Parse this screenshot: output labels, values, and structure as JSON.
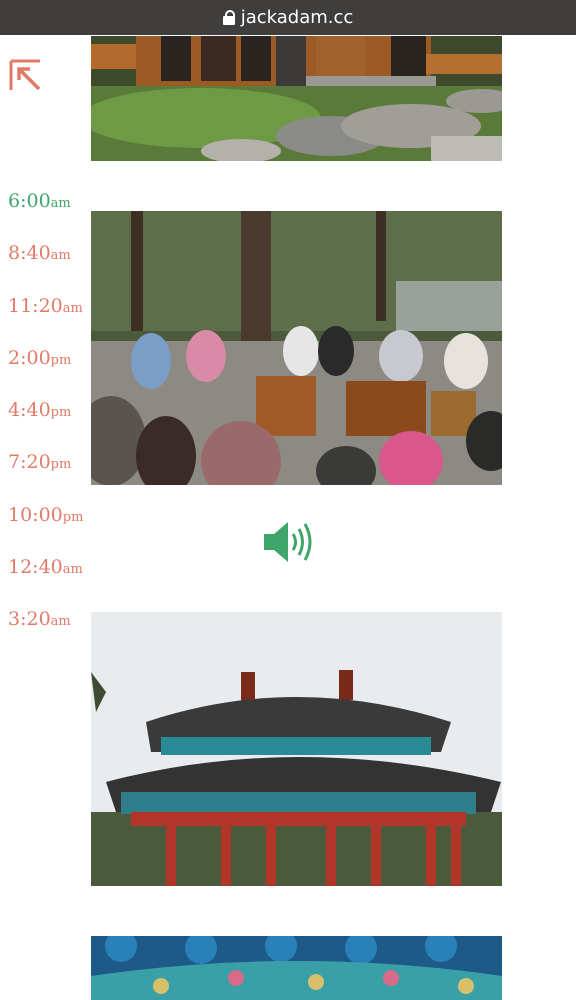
{
  "browser": {
    "url": "jackadam.cc"
  },
  "nav": {
    "back_icon": "arrow-up-left-icon"
  },
  "timeline": {
    "items": [
      {
        "time": "6:00",
        "suffix": "am",
        "active": true
      },
      {
        "time": "8:40",
        "suffix": "am",
        "active": false
      },
      {
        "time": "11:20",
        "suffix": "am",
        "active": false
      },
      {
        "time": "2:00",
        "suffix": "pm",
        "active": false
      },
      {
        "time": "4:40",
        "suffix": "pm",
        "active": false
      },
      {
        "time": "7:20",
        "suffix": "pm",
        "active": false
      },
      {
        "time": "10:00",
        "suffix": "pm",
        "active": false
      },
      {
        "time": "12:40",
        "suffix": "am",
        "active": false
      },
      {
        "time": "3:20",
        "suffix": "am",
        "active": false
      }
    ]
  },
  "audio": {
    "icon": "speaker-icon"
  },
  "colors": {
    "accent": "#e27a68",
    "active": "#3fa56b",
    "urlbar": "#3f3e3d"
  }
}
